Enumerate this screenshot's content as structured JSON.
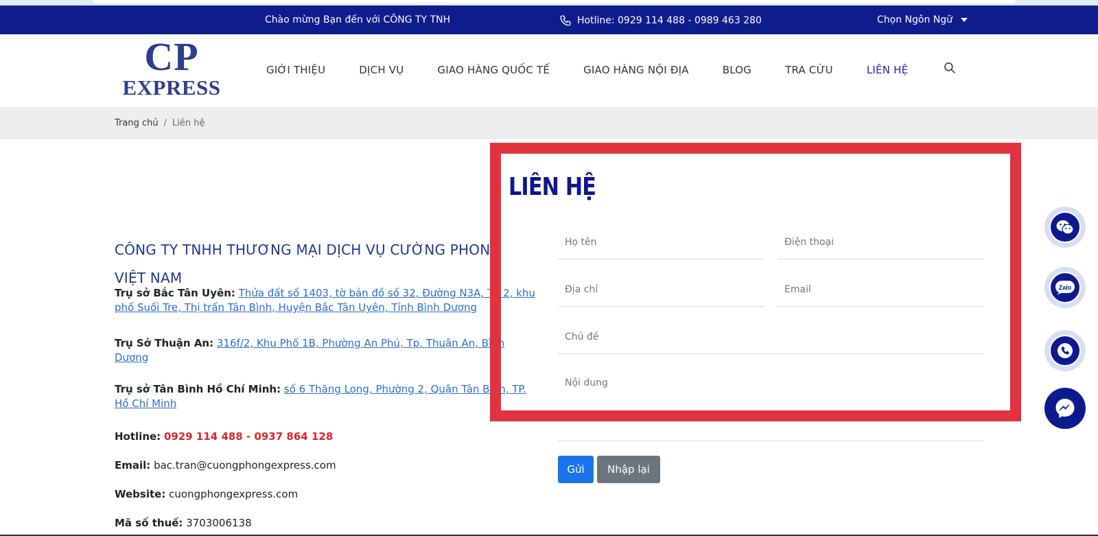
{
  "topbar": {
    "welcome": "Chào mừng Bạn đến với CÔNG TY TNH",
    "hotline": "Hotline: 0929 114 488 - 0989 463 280",
    "language": "Chọn Ngôn Ngữ"
  },
  "logo": {
    "line1": "CP",
    "line2": "EXPRESS"
  },
  "nav": {
    "items": [
      {
        "label": "GIỚI THIỆU"
      },
      {
        "label": "DỊCH VỤ"
      },
      {
        "label": "GIAO HÀNG QUỐC TẾ"
      },
      {
        "label": "GIAO HÀNG NỘI ĐỊA"
      },
      {
        "label": "BLOG"
      },
      {
        "label": "TRA CỨU"
      },
      {
        "label": "LIÊN HỆ"
      }
    ]
  },
  "breadcrumb": {
    "home": "Trang chủ",
    "separator": "/",
    "current": "Liên hệ"
  },
  "company": {
    "name": "CÔNG TY TNHH THƯƠNG MẠI DỊCH VỤ CƯỜNG PHONG VIỆT NAM",
    "hq_bactanuyen_label": "Trụ sở Bắc Tân Uyên:",
    "hq_bactanuyen_address": "Thửa đất số 1403, tờ bản đồ số 32, Đường N3A, Tổ 2, khu phố Suối Tre, Thị trấn Tân Bình, Huyện Bắc Tân Uyên, Tỉnh Bình Dương",
    "hq_thuanan_label": "Trụ Sở Thuận An:",
    "hq_thuanan_address": "316f/2, Khu Phố 1B, Phường An Phú, Tp. Thuận An, Bình Dương",
    "hq_tanbinh_label": "Trụ sở Tân Bình Hồ Chí Minh:",
    "hq_tanbinh_address": "số 6 Thăng Long, Phường 2, Quận Tân Bình, TP. Hồ Chí Minh",
    "hotline_label": "Hotline:",
    "hotline_value": "0929 114 488 - 0937 864 128",
    "email_label": "Email:",
    "email_value": "bac.tran@cuongphongexpress.com",
    "website_label": "Website:",
    "website_value": "cuongphongexpress.com",
    "tax_label": "Mã số thuế:",
    "tax_value": "3703006138"
  },
  "form": {
    "heading": "LIÊN HỆ",
    "name_placeholder": "Họ tên",
    "phone_placeholder": "Điện thoại",
    "address_placeholder": "Địa chỉ",
    "email_placeholder": "Email",
    "subject_placeholder": "Chủ đề",
    "message_placeholder": "Nội dung",
    "send_label": "Gửi",
    "reset_label": "Nhập lại"
  },
  "colors": {
    "brand_navy": "#0f1c8c",
    "highlight_red": "#e0323f",
    "link_blue": "#2a6fc9",
    "send_blue": "#1a73e8",
    "reset_gray": "#6c757d"
  },
  "floating_buttons": [
    "wechat-icon",
    "zalo-icon",
    "phone-icon",
    "messenger-icon"
  ]
}
